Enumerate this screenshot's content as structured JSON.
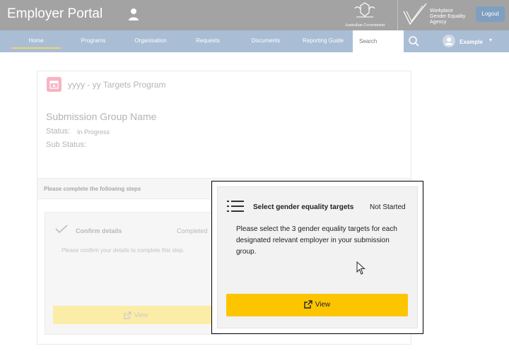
{
  "header": {
    "portal_title": "Employer Portal",
    "crest_text": "Australian Government",
    "wgea_line1": "Workplace",
    "wgea_line2": "Gender Equality",
    "wgea_line3": "Agency",
    "logout_label": "Logout"
  },
  "nav": {
    "items": [
      "Home",
      "Programs",
      "Organisation",
      "Requests",
      "Documents",
      "Reporting Guide"
    ],
    "search_placeholder": "Search",
    "profile_name": "Example",
    "profile_caret": "▾"
  },
  "program": {
    "title": "yyyy - yy Targets Program",
    "group_name": "Submission Group Name",
    "status_label": "Status:",
    "status_value": "In Progress",
    "substatus_label": "Sub Status:",
    "steps_heading": "Please complete the following steps"
  },
  "steps": [
    {
      "title": "Confirm details",
      "status": "Completed",
      "description": "Please confirm your details to complete this step.",
      "view_label": "View"
    },
    {
      "title": "Select gender equality targets",
      "status": "Not Started",
      "description": "Please select the 3 gender equality targets for each designated relevant employer in your submission group.",
      "view_label": "View"
    }
  ],
  "colors": {
    "header_bg": "#a3a3a3",
    "nav_bg": "#a9bdd5",
    "accent_yellow": "#fdc500",
    "logout_bg": "#7f9fc0"
  },
  "icons": [
    "user-icon",
    "crest-logo",
    "wgea-logo",
    "search-icon",
    "avatar",
    "calendar-icon",
    "check-icon",
    "list-icon",
    "external-link-icon",
    "cursor-icon"
  ]
}
